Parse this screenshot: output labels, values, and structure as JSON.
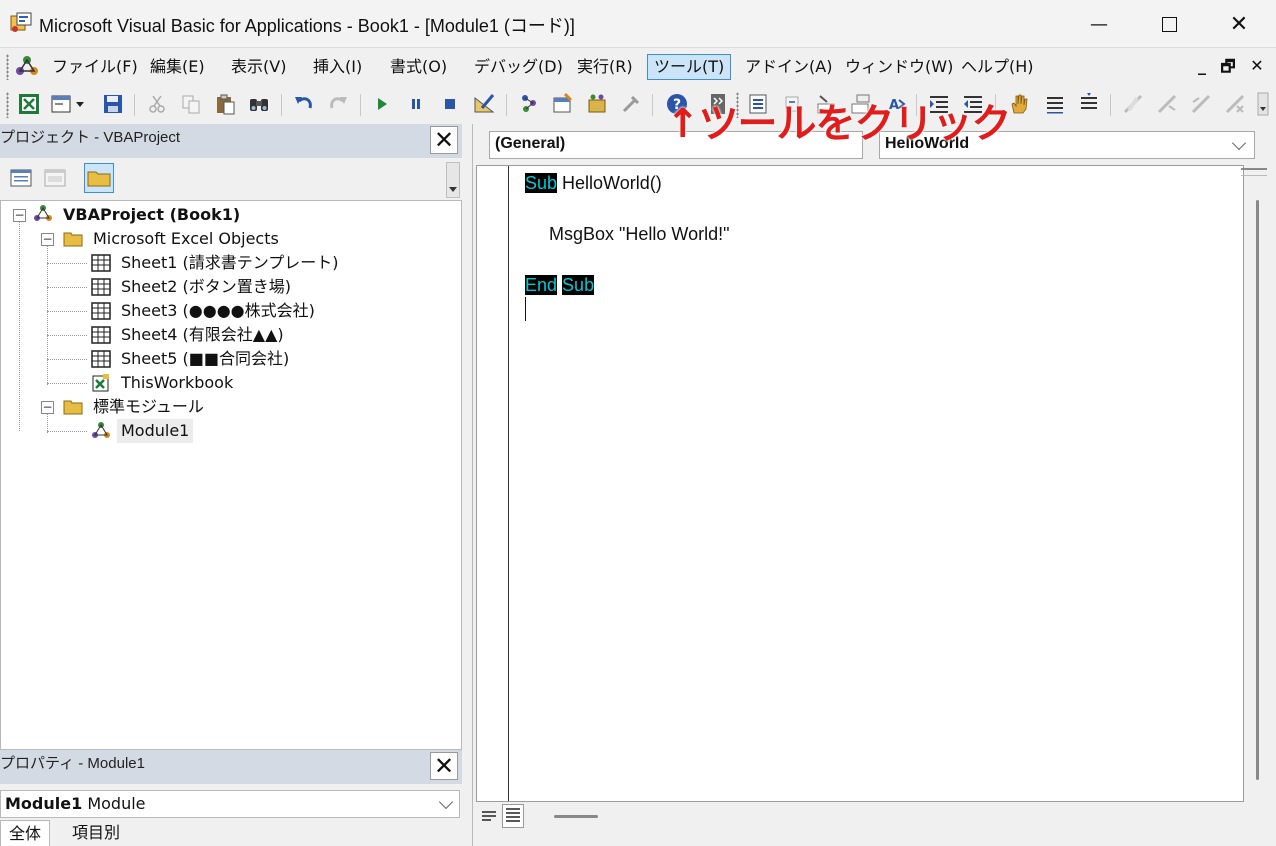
{
  "window": {
    "title": "Microsoft Visual Basic for Applications - Book1 - [Module1 (コード)]",
    "minimize_glyph": "—",
    "close_glyph": "✕"
  },
  "menu": {
    "items": [
      {
        "label": "ファイル(F)",
        "active": false
      },
      {
        "label": "編集(E)",
        "active": false
      },
      {
        "label": "表示(V)",
        "active": false
      },
      {
        "label": "挿入(I)",
        "active": false
      },
      {
        "label": "書式(O)",
        "active": false
      },
      {
        "label": "デバッグ(D)",
        "active": false
      },
      {
        "label": "実行(R)",
        "active": false
      },
      {
        "label": "ツール(T)",
        "active": true
      },
      {
        "label": "アドイン(A)",
        "active": false
      },
      {
        "label": "ウィンドウ(W)",
        "active": false
      },
      {
        "label": "ヘルプ(H)",
        "active": false
      }
    ],
    "mdi_buttons": [
      "_",
      "🗗",
      "✕"
    ]
  },
  "annotation": {
    "text": "↑ツールをクリック",
    "color": "#e21b1b"
  },
  "project_pane": {
    "title": "プロジェクト - VBAProject",
    "close_glyph": "✕",
    "tree": {
      "root": "VBAProject (Book1)",
      "excel_folder": "Microsoft Excel Objects",
      "sheets": [
        "Sheet1 (請求書テンプレート)",
        "Sheet2 (ボタン置き場)",
        "Sheet3 (●●●●株式会社)",
        "Sheet4 (有限会社▲▲)",
        "Sheet5 (■■合同会社)"
      ],
      "workbook": "ThisWorkbook",
      "module_folder": "標準モジュール",
      "module": "Module1"
    }
  },
  "properties_pane": {
    "title": "プロパティ - Module1",
    "close_glyph": "✕",
    "object_name": "Module1",
    "object_type": "Module",
    "tabs": [
      "全体",
      "項目別"
    ]
  },
  "code_window": {
    "object_combo": "(General)",
    "procedure_combo": "HelloWorld",
    "lines": {
      "sub_kw": "Sub",
      "sub_name": " HelloWorld()",
      "msgbox": "MsgBox \"Hello World!\"",
      "end_kw": "End",
      "end_sub_kw": "Sub"
    }
  },
  "colors": {
    "keyword_bg": "#000000",
    "keyword_fg": "#00c8d4",
    "menu_active_bg": "#cce4f7",
    "pane_header_bg": "#d4dae3"
  }
}
